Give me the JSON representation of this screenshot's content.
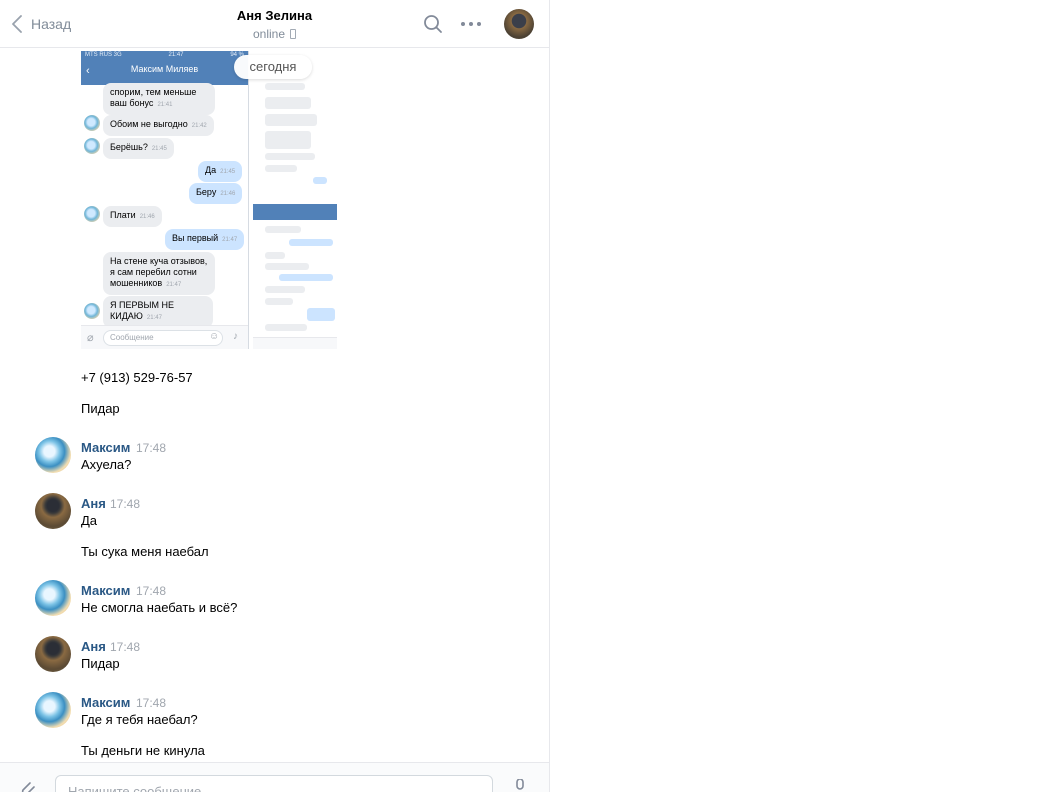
{
  "header": {
    "back_label": "Назад",
    "title": "Аня Зелина",
    "status": "online"
  },
  "date_pill": "сегодня",
  "screenshot": {
    "carrier": "MTS RUS  3G",
    "clock": "21:47",
    "battery": "94 %",
    "contact": "Максим Миляев",
    "input_placeholder": "Сообщение",
    "bubbles": [
      {
        "text": "спорим, тем меньше ваш бонус",
        "time": "21:41"
      },
      {
        "text": "Обоим не выгодно",
        "time": "21:42"
      },
      {
        "text": "Берёшь?",
        "time": "21:45"
      },
      {
        "text": "Да",
        "time": "21:45"
      },
      {
        "text": "Беру",
        "time": "21:46"
      },
      {
        "text": "Плати",
        "time": "21:46"
      },
      {
        "text": "Вы первый",
        "time": "21:47"
      },
      {
        "text": "На стене куча отзывов, я сам перебил сотни мошенников",
        "time": "21:47"
      },
      {
        "text": "Я ПЕРВЫМ НЕ КИДАЮ",
        "time": "21:47"
      }
    ]
  },
  "messages": [
    {
      "text": "+7 (913) 529-76-57"
    },
    {
      "text": "Пидар"
    },
    {
      "author": "Максим",
      "time": "17:48",
      "text": "Ахуела?"
    },
    {
      "author": "Аня",
      "time": "17:48",
      "text": "Да"
    },
    {
      "text": "Ты сука меня наебал"
    },
    {
      "author": "Максим",
      "time": "17:48",
      "text": "Не смогла наебать и всё?"
    },
    {
      "author": "Аня",
      "time": "17:48",
      "text": "Пидар"
    },
    {
      "author": "Максим",
      "time": "17:48",
      "text": "Где я тебя наебал?"
    },
    {
      "text": "Ты деньги не кинула"
    }
  ],
  "composer": {
    "placeholder": "Напишите сообщение..."
  },
  "colors": {
    "author": "#2a5885",
    "muted": "#818c99",
    "outgoing_bubble": "#cce4ff",
    "incoming_bubble": "#ebedf0"
  }
}
